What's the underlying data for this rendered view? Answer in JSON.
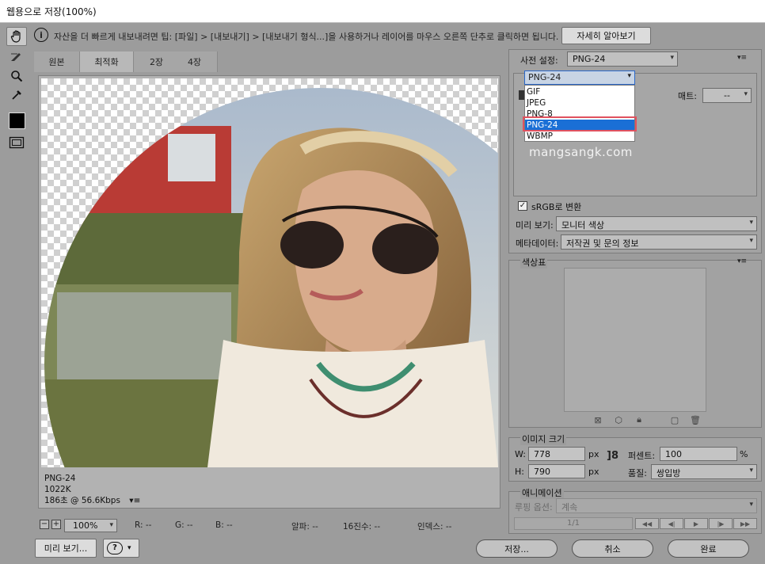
{
  "window": {
    "title": "웹용으로 저장(100%)"
  },
  "info": {
    "tip": "자산을 더 빠르게 내보내려면 팁: [파일] > [내보내기] > [내보내기 형식...]을 사용하거나 레이어를 마우스 오른쪽 단추로 클릭하면 됩니다.",
    "learn_more": "자세히 알아보기"
  },
  "tabs": [
    "원본",
    "최적화",
    "2장",
    "4장"
  ],
  "preview": {
    "format": "PNG-24",
    "size": "1022K",
    "time": "186초 @ 56.6Kbps",
    "watermark": "mangsangk.com"
  },
  "statusbar": {
    "zoom": "100%",
    "r": "R: --",
    "g": "G: --",
    "b": "B: --",
    "alpha": "알파: --",
    "hex": "16진수: --",
    "index": "인덱스: --"
  },
  "bottom": {
    "preview_button": "미리 보기...",
    "save_button": "저장...",
    "cancel_button": "취소",
    "done_button": "완료"
  },
  "settings": {
    "preset_label": "사전 설정:",
    "preset_value": "PNG-24",
    "format_value": "PNG-24",
    "format_options": [
      "GIF",
      "JPEG",
      "PNG-8",
      "PNG-24",
      "WBMP"
    ],
    "selected_option": "PNG-24",
    "matte_label": "매트:",
    "matte_value": "--",
    "srgb_label": "sRGB로 변환",
    "preview_label": "미리 보기:",
    "preview_value": "모니터 색상",
    "metadata_label": "메타데이터:",
    "metadata_value": "저작권 및 문의 정보"
  },
  "color_table": {
    "title": "색상표"
  },
  "image_size": {
    "title": "이미지 크기",
    "w_label": "W:",
    "w_value": "778",
    "w_unit": "px",
    "h_label": "H:",
    "h_value": "790",
    "h_unit": "px",
    "percent_label": "퍼센트:",
    "percent_value": "100",
    "percent_unit": "%",
    "quality_label": "품질:",
    "quality_value": "쌍입방"
  },
  "animation": {
    "title": "애니메이션",
    "loop_label": "루핑 옵션:",
    "loop_value": "계속",
    "frame": "1/1"
  },
  "colors": {
    "selected": "#1a6fd6",
    "highlight": "#e0525f"
  }
}
